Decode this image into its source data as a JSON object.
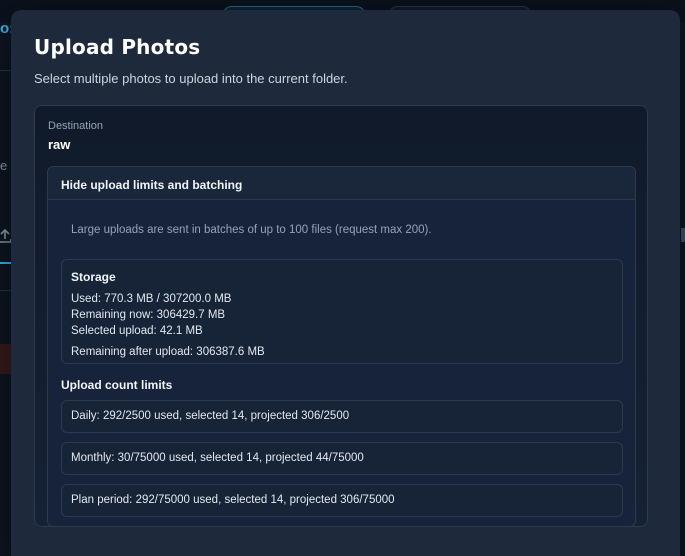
{
  "background": {
    "logo_fragment": "o:",
    "letter_fragment": "e"
  },
  "modal": {
    "title": "Upload Photos",
    "subtitle": "Select multiple photos to upload into the current folder.",
    "destination": {
      "label": "Destination",
      "value": "raw"
    },
    "limits": {
      "toggle_label": "Hide upload limits and batching",
      "batch_note": "Large uploads are sent in batches of up to 100 files (request max 200).",
      "storage": {
        "title": "Storage",
        "used": "Used: 770.3 MB / 307200.0 MB",
        "remaining_now": "Remaining now: 306429.7 MB",
        "selected": "Selected upload: 42.1 MB",
        "remaining_after": "Remaining after upload: 306387.6 MB"
      },
      "count_title": "Upload count limits",
      "counts": [
        "Daily: 292/2500 used, selected 14, projected 306/2500",
        "Monthly: 30/75000 used, selected 14, projected 44/75000",
        "Plan period: 292/75000 used, selected 14, projected 306/75000"
      ]
    }
  },
  "colors": {
    "accent": "#38bdf8",
    "modal_bg": "#1e293b",
    "border": "#2b3a4f"
  }
}
